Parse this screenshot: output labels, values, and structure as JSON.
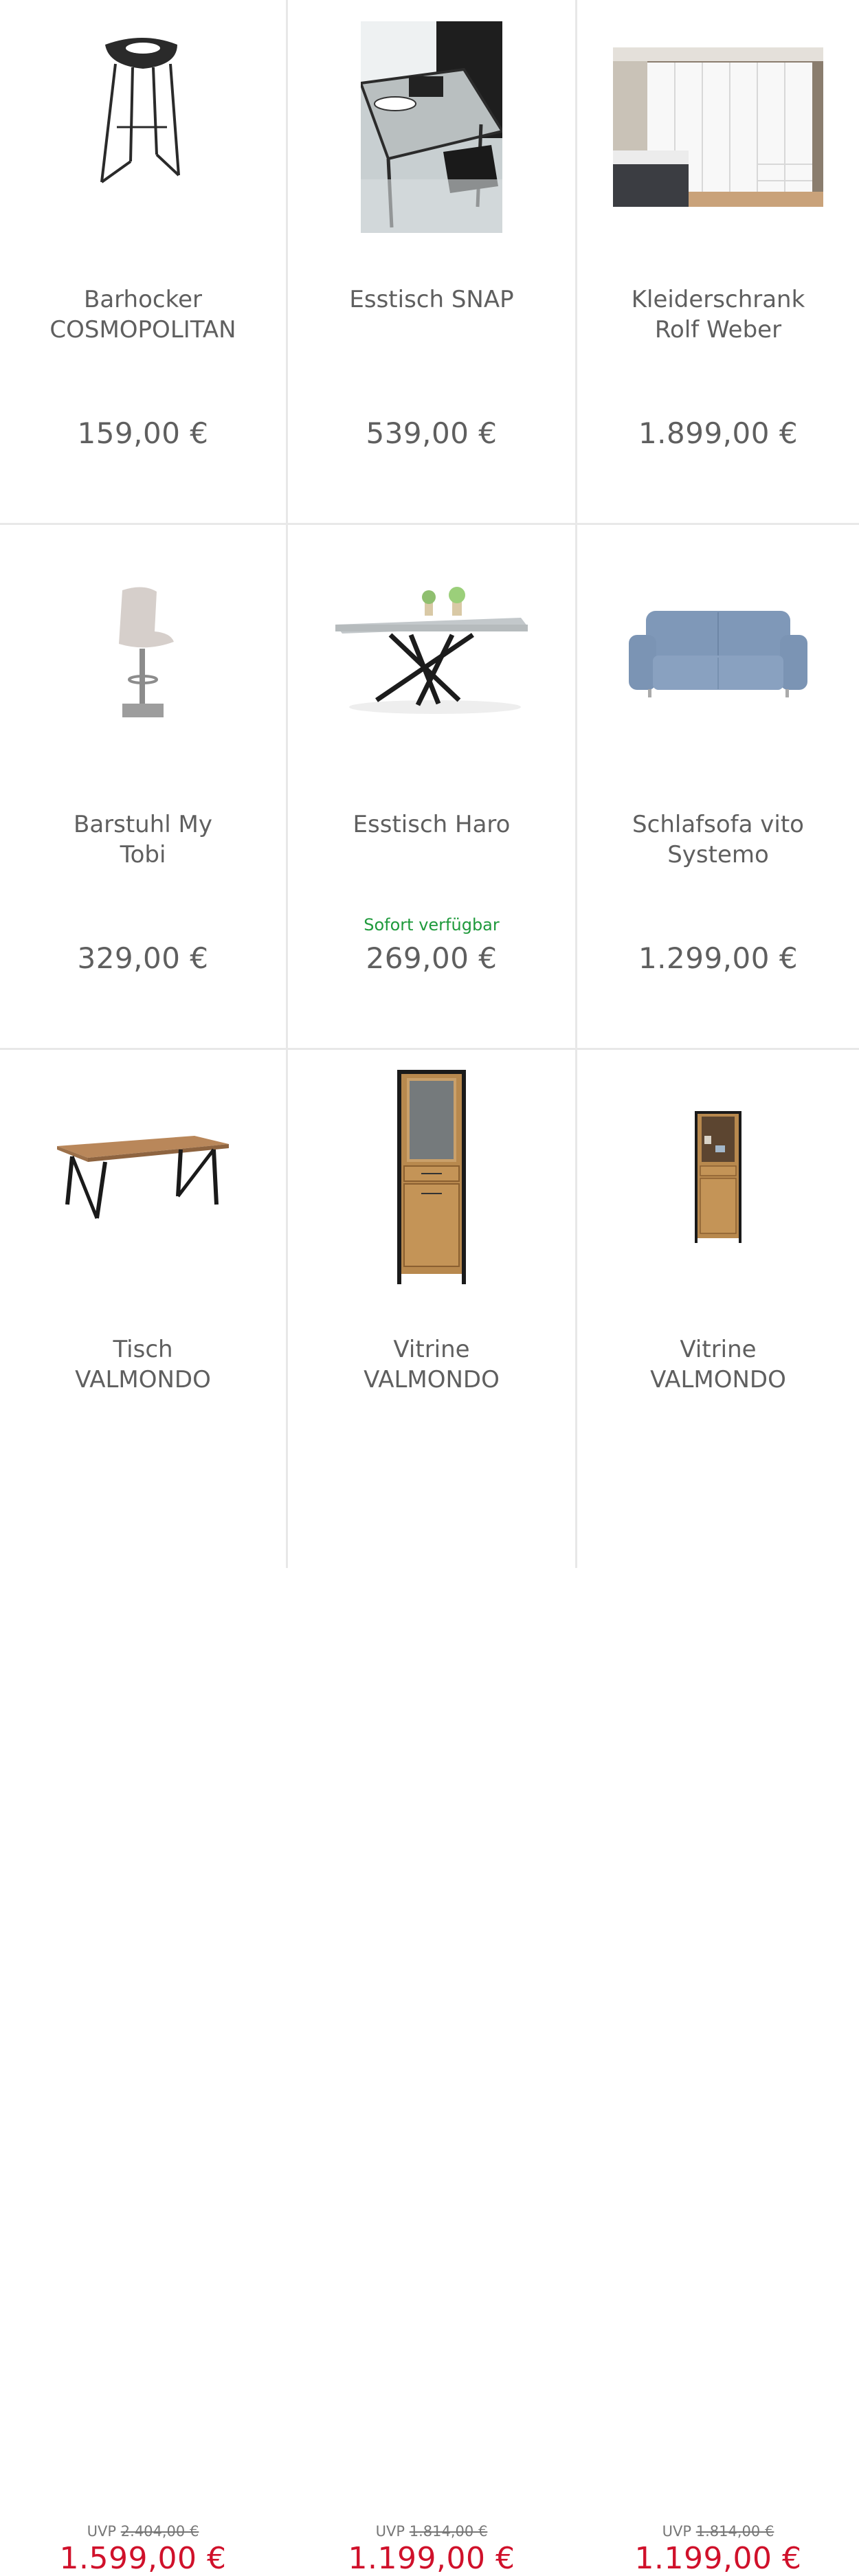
{
  "products": [
    {
      "title_line1": "Barhocker",
      "title_line2": "COSMOPOLITAN",
      "price": "159,00 €",
      "image_icon": "bar-stool-black-icon"
    },
    {
      "title_line1": "Esstisch SNAP",
      "title_line2": "",
      "price": "539,00 €",
      "image_icon": "dining-table-photo-icon"
    },
    {
      "title_line1": "Kleiderschrank",
      "title_line2": "Rolf Weber",
      "price": "1.899,00 €",
      "image_icon": "wardrobe-photo-icon"
    },
    {
      "title_line1": "Barstuhl My",
      "title_line2": "Tobi",
      "price": "329,00 €",
      "image_icon": "bar-chair-beige-icon"
    },
    {
      "title_line1": "Esstisch Haro",
      "title_line2": "",
      "availability": "Sofort verfügbar",
      "price": "269,00 €",
      "image_icon": "dining-table-x-legs-icon"
    },
    {
      "title_line1": "Schlafsofa vito",
      "title_line2": "Systemo",
      "price": "1.299,00 €",
      "image_icon": "sofa-blue-icon"
    },
    {
      "title_line1": "Tisch",
      "title_line2": "VALMONDO",
      "uvp_label": "UVP",
      "uvp_price": "2.404,00 €",
      "price": "1.599,00 €",
      "image_icon": "wood-table-icon"
    },
    {
      "title_line1": "Vitrine",
      "title_line2": "VALMONDO",
      "uvp_label": "UVP",
      "uvp_price": "1.814,00 €",
      "price": "1.199,00 €",
      "image_icon": "tall-cabinet-icon"
    },
    {
      "title_line1": "Vitrine",
      "title_line2": "VALMONDO",
      "uvp_label": "UVP",
      "uvp_price": "1.814,00 €",
      "price": "1.199,00 €",
      "image_icon": "narrow-cabinet-icon"
    }
  ],
  "colors": {
    "sale_price": "#d0112b",
    "availability": "#1f9a3c",
    "text": "#5f5f5f",
    "divider": "#e8e8e8"
  }
}
